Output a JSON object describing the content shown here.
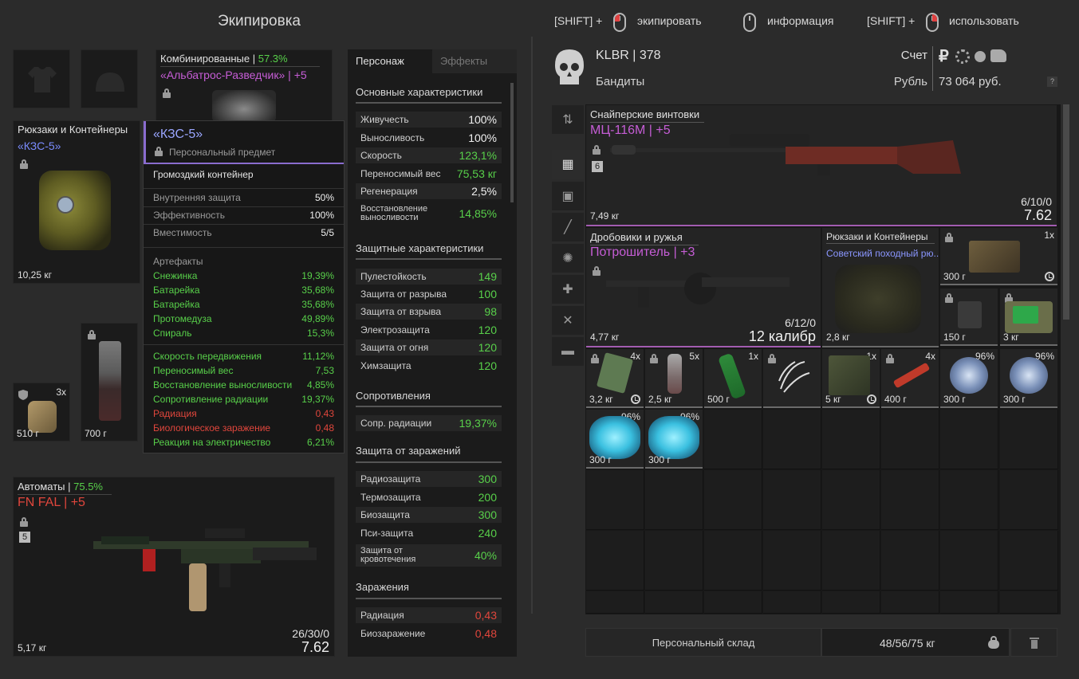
{
  "header": {
    "title": "Экипировка",
    "shift1": "[SHIFT] +",
    "equip": "экипировать",
    "info": "информация",
    "shift2": "[SHIFT] +",
    "use": "использовать"
  },
  "equipment": {
    "armor": {
      "category": "Комбинированные",
      "sep": " | ",
      "pct": "57.3%",
      "name": "«Альбатрос-Разведчик» | +5"
    },
    "backpack": {
      "category": "Рюкзаки и Контейнеры",
      "name": "«КЗС-5»",
      "weight": "10,25 кг"
    },
    "artifact_slot": {
      "count": "3x",
      "weight": "510 г"
    },
    "knife": {
      "weight": "700 г"
    },
    "rifle": {
      "category": "Автоматы",
      "sep": " | ",
      "pct": "75.5%",
      "name": "FN FAL | +5",
      "badge": "5",
      "ammo": "26/30/0",
      "caliber": "7.62",
      "weight": "5,17 кг"
    }
  },
  "tooltip": {
    "name": "«КЗС-5»",
    "personal": "Персональный предмет",
    "type": "Громоздкий контейнер",
    "props": [
      {
        "label": "Внутренняя защита",
        "value": "50%"
      },
      {
        "label": "Эффективность",
        "value": "100%"
      },
      {
        "label": "Вместимость",
        "value": "5/5"
      }
    ],
    "artifacts_title": "Артефакты",
    "artifacts": [
      {
        "label": "Снежинка",
        "value": "19,39%"
      },
      {
        "label": "Батарейка",
        "value": "35,68%"
      },
      {
        "label": "Батарейка",
        "value": "35,68%"
      },
      {
        "label": "Протомедуза",
        "value": "49,89%"
      },
      {
        "label": "Спираль",
        "value": "15,3%"
      }
    ],
    "effects": [
      {
        "label": "Скорость передвижения",
        "value": "11,12%",
        "color": "green"
      },
      {
        "label": "Переносимый вес",
        "value": "7,53",
        "color": "green"
      },
      {
        "label": "Восстановление выносливости",
        "value": "4,85%",
        "color": "green"
      },
      {
        "label": "Сопротивление радиации",
        "value": "19,37%",
        "color": "green"
      },
      {
        "label": "Радиация",
        "value": "0,43",
        "color": "red"
      },
      {
        "label": "Биологическое заражение",
        "value": "0,48",
        "color": "red"
      },
      {
        "label": "Реакция на электричество",
        "value": "6,21%",
        "color": "green"
      }
    ]
  },
  "stats": {
    "tab_character": "Персонаж",
    "tab_effects": "Эффекты",
    "main_title": "Основные характеристики",
    "main": [
      {
        "label": "Живучесть",
        "value": "100%",
        "color": "white"
      },
      {
        "label": "Выносливость",
        "value": "100%",
        "color": "white"
      },
      {
        "label": "Скорость",
        "value": "123,1%",
        "color": "green"
      },
      {
        "label": "Переносимый вес",
        "value": "75,53 кг",
        "color": "green"
      },
      {
        "label": "Регенерация",
        "value": "2,5%",
        "color": "white"
      },
      {
        "label": "Восстановление выносливости",
        "value": "14,85%",
        "color": "green"
      }
    ],
    "def_title": "Защитные характеристики",
    "def": [
      {
        "label": "Пулестойкость",
        "value": "149"
      },
      {
        "label": "Защита от разрыва",
        "value": "100"
      },
      {
        "label": "Защита от взрыва",
        "value": "98"
      },
      {
        "label": "Электрозащита",
        "value": "120"
      },
      {
        "label": "Защита от огня",
        "value": "120"
      },
      {
        "label": "Химзащита",
        "value": "120"
      }
    ],
    "res_title": "Сопротивления",
    "res": [
      {
        "label": "Сопр. радиации",
        "value": "19,37%"
      }
    ],
    "inf_title": "Защита от заражений",
    "inf": [
      {
        "label": "Радиозащита",
        "value": "300"
      },
      {
        "label": "Термозащита",
        "value": "200"
      },
      {
        "label": "Биозащита",
        "value": "300"
      },
      {
        "label": "Пси-защита",
        "value": "240"
      },
      {
        "label": "Защита от кровотечения",
        "value": "40%"
      }
    ],
    "cont_title": "Заражения",
    "cont": [
      {
        "label": "Радиация",
        "value": "0,43"
      },
      {
        "label": "Биозаражение",
        "value": "0,48"
      }
    ]
  },
  "player": {
    "name": "KLBR | 378",
    "faction": "Бандиты",
    "account_label": "Счет",
    "currency": "Рубль",
    "balance": "73 064 руб.",
    "help": "?"
  },
  "inventory": {
    "sniper": {
      "category": "Снайперские винтовки",
      "name": "МЦ-116М | +5",
      "badge": "6",
      "ammo": "6/10/0",
      "caliber": "7.62",
      "weight": "7,49 кг"
    },
    "shotgun": {
      "category": "Дробовики и ружья",
      "name": "Потрошитель | +3",
      "ammo": "6/12/0",
      "caliber": "12 калибр",
      "weight": "4,77 кг"
    },
    "bag": {
      "category": "Рюкзаки и Контейнеры",
      "name": "Советский походный рю...",
      "weight": "2,8 кг"
    },
    "box1": {
      "count": "1x",
      "weight": "300 г"
    },
    "radio": {
      "weight": "150 г"
    },
    "device": {
      "weight": "3 кг"
    },
    "row3": [
      {
        "count": "4x",
        "weight": "3,2 кг"
      },
      {
        "count": "5x",
        "weight": "2,5 кг"
      },
      {
        "count": "1x",
        "weight": "500 г"
      },
      {
        "count": "",
        "weight": ""
      },
      {
        "count": "1x",
        "weight": "5 кг"
      },
      {
        "count": "4x",
        "weight": "400 г"
      },
      {
        "count": "96%",
        "weight": "300 г"
      },
      {
        "count": "96%",
        "weight": "300 г"
      }
    ],
    "row4": [
      {
        "count": "96%",
        "weight": "300 г"
      },
      {
        "count": "96%",
        "weight": "300 г"
      }
    ]
  },
  "footer": {
    "stash": "Персональный склад",
    "weight": "48/56/75 кг"
  }
}
